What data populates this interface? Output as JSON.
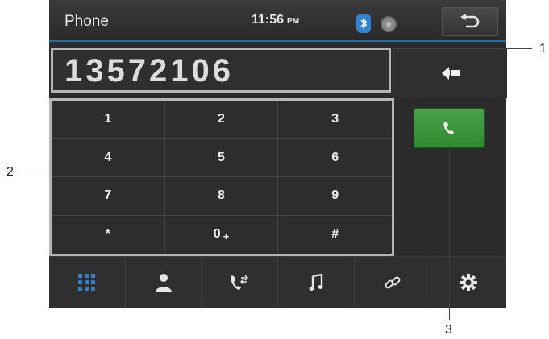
{
  "statusbar": {
    "title": "Phone",
    "time": "11:56",
    "ampm": "PM",
    "bluetooth_icon": "bluetooth-icon",
    "disc_icon": "disc-icon",
    "back_icon": "back-arrow-icon"
  },
  "dialer": {
    "number": "13572106",
    "backspace_icon": "backspace-icon"
  },
  "keypad": {
    "keys": [
      {
        "main": "1",
        "sub": ""
      },
      {
        "main": "2",
        "sub": ""
      },
      {
        "main": "3",
        "sub": ""
      },
      {
        "main": "4",
        "sub": ""
      },
      {
        "main": "5",
        "sub": ""
      },
      {
        "main": "6",
        "sub": ""
      },
      {
        "main": "7",
        "sub": ""
      },
      {
        "main": "8",
        "sub": ""
      },
      {
        "main": "9",
        "sub": ""
      },
      {
        "main": "*",
        "sub": ""
      },
      {
        "main": "0",
        "sub": "+"
      },
      {
        "main": "#",
        "sub": ""
      }
    ]
  },
  "call_button": {
    "icon": "phone-handset-icon"
  },
  "bottom_nav": [
    {
      "icon": "keypad-grid-icon",
      "active": true
    },
    {
      "icon": "contacts-person-icon"
    },
    {
      "icon": "call-log-icon"
    },
    {
      "icon": "music-note-icon"
    },
    {
      "icon": "link-icon"
    },
    {
      "icon": "gear-icon"
    }
  ],
  "callouts": [
    "1",
    "2",
    "3"
  ],
  "colors": {
    "accent": "#1f6ea8",
    "call_green": "#3a963a",
    "active_nav": "#2e82cf",
    "panel_border": "#b4b4b4"
  }
}
